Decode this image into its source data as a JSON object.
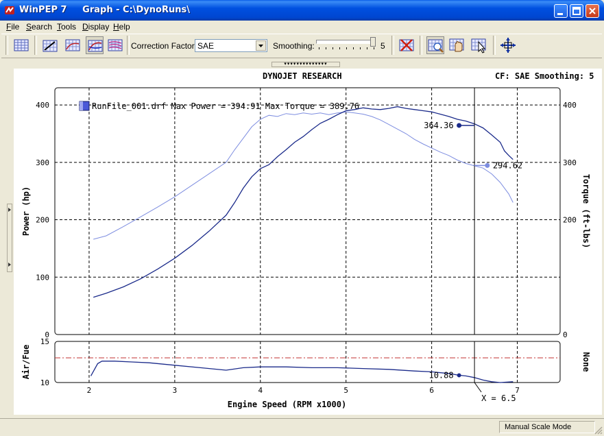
{
  "window": {
    "title": "WinPEP 7     Graph - C:\\DynoRuns\\"
  },
  "menu": {
    "items": [
      {
        "label": "File",
        "accel": "F",
        "rest": "ile"
      },
      {
        "label": "Search",
        "accel": "S",
        "rest": "earch"
      },
      {
        "label": "Tools",
        "accel": "T",
        "rest": "ools"
      },
      {
        "label": "Display",
        "accel": "D",
        "rest": "isplay"
      },
      {
        "label": "Help",
        "accel": "H",
        "rest": "elp"
      }
    ]
  },
  "toolbar": {
    "correction_label": "Correction Factor:",
    "correction_value": "SAE",
    "smoothing_label": "Smoothing:",
    "smoothing_value": "5",
    "smoothing_level": 5,
    "smoothing_max": 5
  },
  "graph_header": {
    "company": "DYNOJET RESEARCH",
    "settings": "CF: SAE  Smoothing: 5"
  },
  "status": {
    "mode": "Manual Scale Mode"
  },
  "colors": {
    "power": "#1a2a8a",
    "torque": "#7d8de0",
    "afr_ref": "#c03030",
    "cursor": "#000000"
  },
  "chart_data": [
    {
      "type": "line",
      "legend_text": "RunFile_001.drf Max Power = 394.91 Max Torque = 389.76",
      "ylabel": "Power (hp)",
      "y2label": "Torque (ft-lbs)",
      "xlim": [
        1.6,
        7.5
      ],
      "ylim": [
        0,
        430
      ],
      "y2lim": [
        0,
        430
      ],
      "x_ticks": [
        2,
        3,
        4,
        5,
        6,
        7
      ],
      "y_ticks": [
        0,
        100,
        200,
        300,
        400
      ],
      "y_tick_labels": [
        "0",
        "100",
        "200",
        "300",
        "400"
      ],
      "y2_tick_labels": [
        "0",
        "200",
        "300",
        "400"
      ],
      "y2_tick_values": [
        0,
        200,
        300,
        400
      ],
      "grid": true,
      "cursor_x": 6.5,
      "series": [
        {
          "name": "Power",
          "x": [
            2.05,
            2.2,
            2.4,
            2.6,
            2.8,
            3.0,
            3.2,
            3.4,
            3.6,
            3.7,
            3.8,
            3.9,
            4.0,
            4.1,
            4.2,
            4.3,
            4.4,
            4.5,
            4.6,
            4.7,
            4.8,
            4.9,
            5.0,
            5.1,
            5.2,
            5.3,
            5.4,
            5.5,
            5.6,
            5.7,
            5.8,
            5.9,
            6.0,
            6.1,
            6.2,
            6.3,
            6.4,
            6.5,
            6.6,
            6.7,
            6.8,
            6.85,
            6.9,
            6.95
          ],
          "y": [
            65,
            72,
            83,
            97,
            114,
            133,
            155,
            180,
            208,
            230,
            255,
            275,
            289,
            296,
            310,
            322,
            335,
            345,
            357,
            368,
            375,
            383,
            390,
            392,
            395,
            393,
            392,
            394,
            397,
            394,
            392,
            390,
            388,
            384,
            380,
            375,
            372,
            367,
            360,
            348,
            335,
            320,
            312,
            305
          ]
        },
        {
          "name": "Torque",
          "x": [
            2.05,
            2.2,
            2.4,
            2.6,
            2.8,
            3.0,
            3.2,
            3.4,
            3.6,
            3.7,
            3.8,
            3.9,
            4.0,
            4.1,
            4.2,
            4.3,
            4.4,
            4.5,
            4.6,
            4.7,
            4.8,
            4.9,
            5.0,
            5.1,
            5.2,
            5.3,
            5.4,
            5.5,
            5.6,
            5.7,
            5.8,
            5.9,
            6.0,
            6.1,
            6.2,
            6.3,
            6.4,
            6.5,
            6.6,
            6.7,
            6.8,
            6.9,
            6.95
          ],
          "y": [
            166,
            172,
            188,
            205,
            222,
            240,
            260,
            280,
            300,
            322,
            342,
            362,
            375,
            382,
            380,
            385,
            383,
            386,
            384,
            386,
            383,
            386,
            388,
            386,
            384,
            380,
            374,
            366,
            358,
            350,
            340,
            332,
            325,
            318,
            312,
            304,
            298,
            294,
            290,
            280,
            265,
            245,
            230
          ]
        }
      ],
      "annotations": [
        {
          "series": "Power",
          "x": 6.32,
          "y": 364.36,
          "label": "364.36"
        },
        {
          "series": "Torque",
          "x": 6.65,
          "y": 294.62,
          "label": "294.62"
        }
      ]
    },
    {
      "type": "line",
      "xlabel": "Engine Speed (RPM x1000)",
      "ylabel": "Air/Fue",
      "y2label": "None",
      "xlim": [
        1.6,
        7.5
      ],
      "ylim": [
        10,
        15
      ],
      "x_ticks": [
        2,
        3,
        4,
        5,
        6,
        7
      ],
      "x_tick_labels": [
        "2",
        "3",
        "4",
        "5",
        "6",
        "7"
      ],
      "y_ticks": [
        10,
        15
      ],
      "y_tick_labels": [
        "10",
        "15"
      ],
      "reference_line": 13,
      "cursor_x": 6.5,
      "cursor_label": "X = 6.5",
      "series": [
        {
          "name": "Air/Fuel",
          "x": [
            2.02,
            2.1,
            2.15,
            2.3,
            2.5,
            2.7,
            3.0,
            3.3,
            3.6,
            3.8,
            4.0,
            4.3,
            4.6,
            4.9,
            5.2,
            5.5,
            5.8,
            6.0,
            6.2,
            6.32,
            6.4,
            6.5,
            6.6,
            6.7,
            6.8,
            6.95
          ],
          "y": [
            10.8,
            12.3,
            12.6,
            12.6,
            12.5,
            12.4,
            12.1,
            11.8,
            11.5,
            11.8,
            11.9,
            11.9,
            11.8,
            11.8,
            11.7,
            11.6,
            11.4,
            11.3,
            11.1,
            10.88,
            10.8,
            10.6,
            10.3,
            10.1,
            10.0,
            10.1
          ]
        }
      ],
      "annotations": [
        {
          "series": "Air/Fuel",
          "x": 6.32,
          "y": 10.88,
          "label": "10.88"
        }
      ]
    }
  ]
}
